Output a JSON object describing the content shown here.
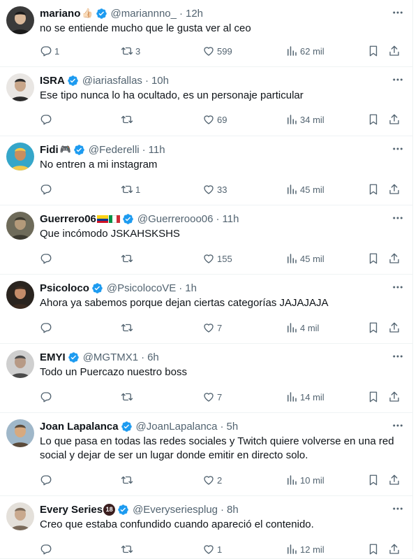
{
  "colors": {
    "accent": "#1d9bf0",
    "text": "#0f1419",
    "muted": "#536471",
    "divider": "#eff3f4"
  },
  "icons": {
    "more": "ellipsis-icon",
    "verified": "verified-badge-icon",
    "reply": "reply-icon",
    "retweet": "retweet-icon",
    "like": "heart-icon",
    "views": "views-icon",
    "bookmark": "bookmark-icon",
    "share": "share-icon"
  },
  "tweets": [
    {
      "name": "mariano",
      "emoji": "👍🏻",
      "handle": "@mariannno_",
      "time": "12h",
      "text": "no se entiende mucho que le gusta ver al ceo",
      "replies": "1",
      "retweets": "3",
      "likes": "599",
      "views": "62 mil"
    },
    {
      "name": "ISRA",
      "emoji": "",
      "handle": "@iariasfallas",
      "time": "10h",
      "text": "Ese tipo nunca lo ha ocultado, es un personaje particular",
      "replies": "",
      "retweets": "",
      "likes": "69",
      "views": "34 mil"
    },
    {
      "name": "Fidi",
      "emoji": "🎮",
      "handle": "@Federelli",
      "time": "11h",
      "text": "No entren a mi instagram",
      "replies": "",
      "retweets": "1",
      "likes": "33",
      "views": "45 mil"
    },
    {
      "name": "Guerrero06",
      "emoji": "",
      "handle": "@Guerrerooo06",
      "time": "11h",
      "text": "Que incómodo JSKAHSKSHS",
      "replies": "",
      "retweets": "",
      "likes": "155",
      "views": "45 mil"
    },
    {
      "name": "Psicoloco",
      "emoji": "",
      "handle": "@PsicolocoVE",
      "time": "1h",
      "text": "Ahora ya sabemos porque dejan ciertas categorías JAJAJAJA",
      "replies": "",
      "retweets": "",
      "likes": "7",
      "views": "4 mil"
    },
    {
      "name": "EMYI",
      "emoji": "",
      "handle": "@MGTMX1",
      "time": "6h",
      "text": "Todo un Puercazo nuestro boss",
      "replies": "",
      "retweets": "",
      "likes": "7",
      "views": "14 mil"
    },
    {
      "name": "Joan Lapalanca",
      "emoji": "",
      "handle": "@JoanLapalanca",
      "time": "5h",
      "text": "Lo que pasa en todas las redes sociales y Twitch quiere volverse en una red social y dejar de ser un lugar donde emitir en directo solo.",
      "replies": "",
      "retweets": "",
      "likes": "2",
      "views": "10 mil"
    },
    {
      "name": "Every Series",
      "emoji": "",
      "handle": "@Everyseriesplug",
      "time": "8h",
      "text": "Creo que estaba confundido cuando apareció el contenido.",
      "replies": "",
      "retweets": "",
      "likes": "1",
      "views": "12 mil"
    }
  ],
  "badges": {
    "adult_badge": "18"
  }
}
